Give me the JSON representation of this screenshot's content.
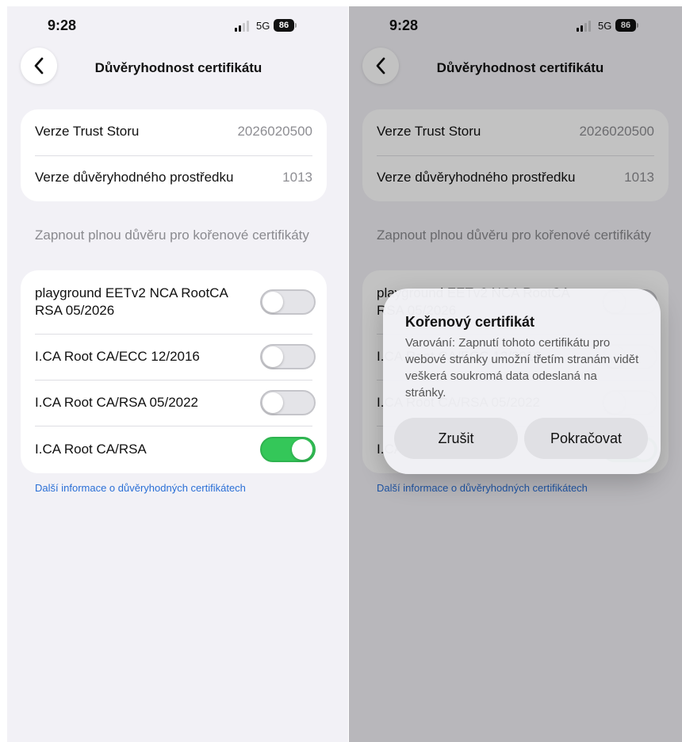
{
  "status_bar": {
    "time": "9:28",
    "network": "5G",
    "battery": "86"
  },
  "nav": {
    "title": "Důvěryhodnost certifikátu"
  },
  "info": [
    {
      "label": "Verze Trust Storu",
      "value": "2026020500"
    },
    {
      "label": "Verze důvěryhodného prostředku",
      "value": "1013"
    }
  ],
  "section_title": "Zapnout plnou důvěru pro kořenové certifikáty",
  "certificates": [
    {
      "label": "playground EETv2 NCA RootCA RSA 05/2026",
      "enabled": false
    },
    {
      "label": "I.CA Root CA/ECC 12/2016",
      "enabled": false
    },
    {
      "label": "I.CA Root CA/RSA 05/2022",
      "enabled": false
    },
    {
      "label": "I.CA Root CA/RSA",
      "enabled": true
    }
  ],
  "footer_link": "Další informace o důvěryhodných certifikátech",
  "dialog": {
    "title": "Kořenový certifikát",
    "message": "Varování: Zapnutí tohoto certifikátu pro webové stránky umožní třetím stranám vidět veškerá soukromá data odeslaná na stránky.",
    "cancel_label": "Zrušit",
    "confirm_label": "Pokračovat"
  },
  "colors": {
    "toggle_on": "#34c759",
    "link": "#2a6fd6",
    "background": "#f2f1f6"
  }
}
